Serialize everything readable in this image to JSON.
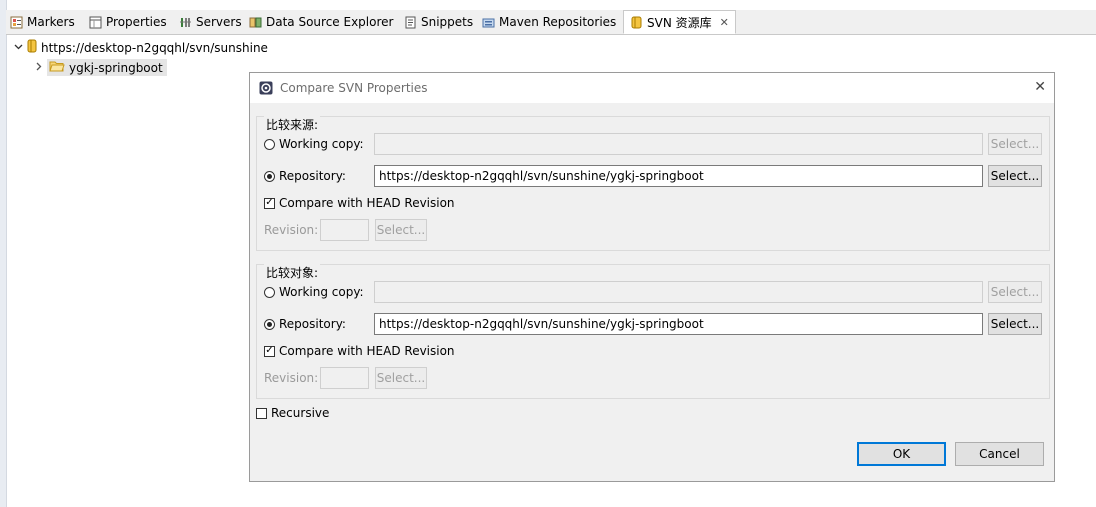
{
  "tabs": [
    {
      "label": "Markers",
      "icon": "markers-icon"
    },
    {
      "label": "Properties",
      "icon": "properties-icon"
    },
    {
      "label": "Servers",
      "icon": "servers-icon"
    },
    {
      "label": "Data Source Explorer",
      "icon": "data-source-icon"
    },
    {
      "label": "Snippets",
      "icon": "snippets-icon"
    },
    {
      "label": "Maven Repositories",
      "icon": "maven-repositories-icon"
    },
    {
      "label": "SVN 资源库",
      "icon": "svn-repository-icon",
      "active": true
    }
  ],
  "tree": {
    "root_label": "https://desktop-n2gqqhl/svn/sunshine",
    "child_label": "ygkj-springboot"
  },
  "dialog": {
    "title": "Compare SVN Properties",
    "source": {
      "group_label": "比较来源:",
      "working_copy_label": "Working copy:",
      "repository_label": "Repository:",
      "repository_value": "https://desktop-n2gqqhl/svn/sunshine/ygkj-springboot",
      "select_label": "Select...",
      "head_label": "Compare with HEAD Revision",
      "revision_label": "Revision:"
    },
    "target": {
      "group_label": "比较对象:",
      "working_copy_label": "Working copy:",
      "repository_label": "Repository:",
      "repository_value": "https://desktop-n2gqqhl/svn/sunshine/ygkj-springboot",
      "select_label": "Select...",
      "head_label": "Compare with HEAD Revision",
      "revision_label": "Revision:"
    },
    "recursive_label": "Recursive",
    "ok_label": "OK",
    "cancel_label": "Cancel"
  },
  "colors": {
    "accent": "#0078d7",
    "tab_bar": "#f0f0f0",
    "dialog_bg": "#f0f0f0"
  }
}
